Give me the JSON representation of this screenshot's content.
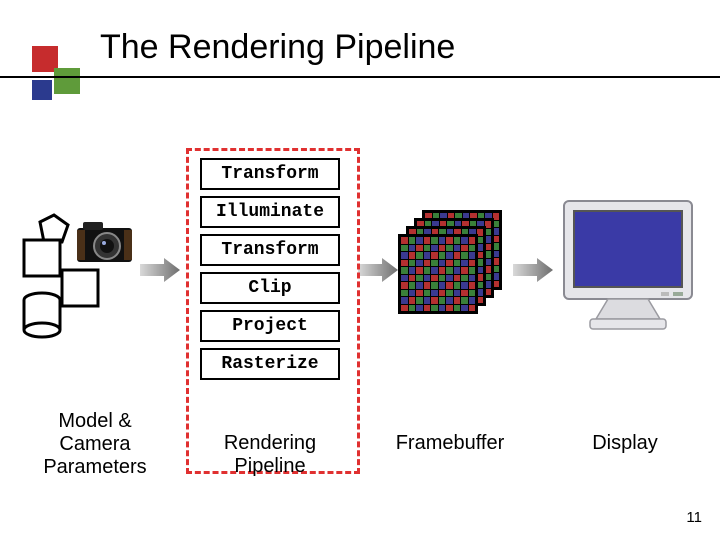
{
  "title": "The Rendering Pipeline",
  "logo_colors": {
    "red": "#c62c2d",
    "green": "#5f9b3a",
    "blue": "#2b3a8e"
  },
  "pipeline": {
    "stages": [
      "Transform",
      "Illuminate",
      "Transform",
      "Clip",
      "Project",
      "Rasterize"
    ]
  },
  "labels": {
    "model": "Model & Camera Parameters",
    "pipeline": "Rendering Pipeline",
    "framebuffer": "Framebuffer",
    "display": "Display"
  },
  "page_number": "11",
  "arrow_gradient": {
    "from": "#d9d9d9",
    "to": "#6e6e6e"
  },
  "monitor": {
    "screen_color": "#3a3aa6",
    "bezel": "#e6e6ea"
  },
  "framebuffer_colors": {
    "r": "#b43030",
    "g": "#3a803a",
    "b": "#3a3a90"
  }
}
